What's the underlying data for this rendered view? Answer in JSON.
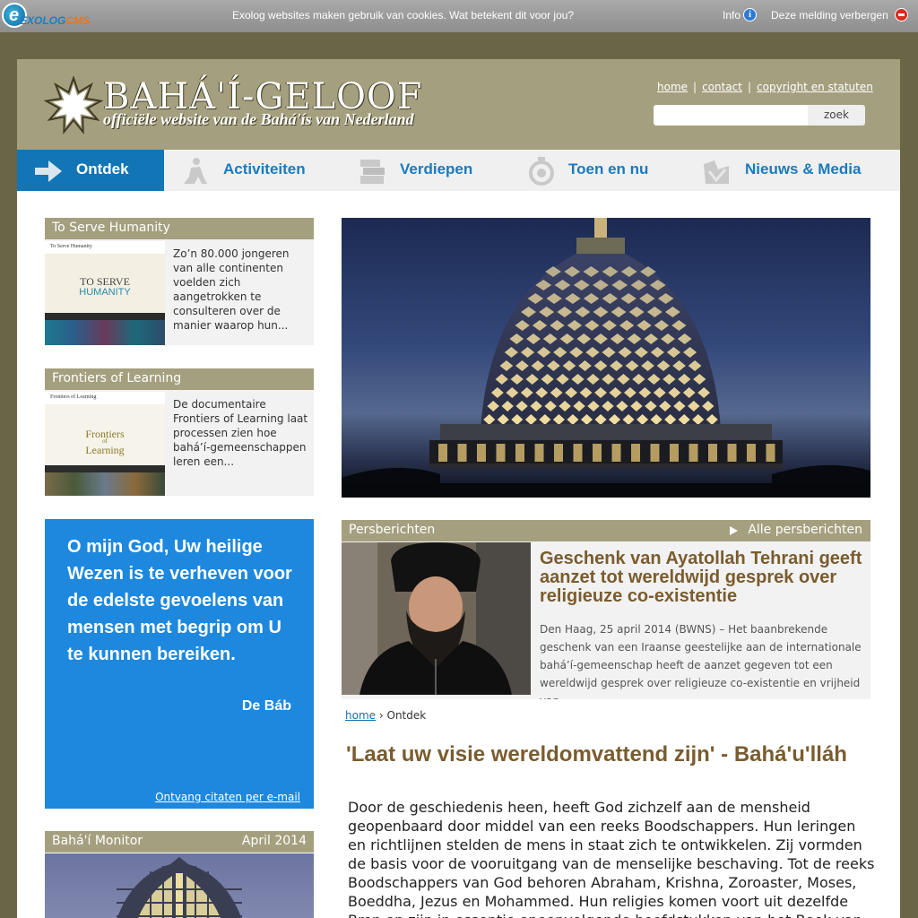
{
  "cookiebar": {
    "logo_text": "EXOLOG",
    "logo_text2": "CMS",
    "message": "Exolog websites maken gebruik van cookies. Wat betekent dit voor jou?",
    "info_label": "Info",
    "hide_label": "Deze melding verbergen"
  },
  "header": {
    "title": "BAHÁ'Í-GELOOF",
    "subtitle": "officiële website van de Bahá'ís van Nederland",
    "links": [
      "home",
      "contact",
      "copyright en statuten"
    ],
    "search_placeholder": "",
    "search_button": "zoek"
  },
  "nav": {
    "items": [
      {
        "label": "Ontdek",
        "icon": "arrow-right-icon",
        "active": true
      },
      {
        "label": "Activiteiten",
        "icon": "activity-icon",
        "active": false
      },
      {
        "label": "Verdiepen",
        "icon": "books-icon",
        "active": false
      },
      {
        "label": "Toen en nu",
        "icon": "stopwatch-icon",
        "active": false
      },
      {
        "label": "Nieuws & Media",
        "icon": "news-icon",
        "active": false
      }
    ]
  },
  "cards": [
    {
      "title": "To Serve Humanity",
      "thumb_small": "To Serve Humanity",
      "thumb_line1": "TO SERVE",
      "thumb_line2": "HUMANITY",
      "text": "Zo’n 80.000 jongeren van alle continenten voelden zich aangetrokken te consulteren over de manier waarop hun..."
    },
    {
      "title": "Frontiers of Learning",
      "thumb_small": "Frontiers of Learning",
      "thumb_line1": "Frontiers",
      "thumb_line2": "of",
      "thumb_line3": "Learning",
      "text": "De documentaire Frontiers of Learning laat processen zien hoe bahá’í-gemeenschappen leren een..."
    }
  ],
  "quote": {
    "text": "O mijn God, Uw heilige Wezen is te verheven voor de edelste gevoelens van mensen met begrip om U te kunnen bereiken.",
    "author": "De Báb",
    "link": "Ontvang citaten per e-mail"
  },
  "monitor": {
    "title": "Bahá'í Monitor",
    "date": "April 2014"
  },
  "press": {
    "section": "Persberichten",
    "all_link": "Alle persberichten",
    "title": "Geschenk van Ayatollah Tehrani geeft aanzet tot wereldwijd gesprek over religieuze co-existentie",
    "body": "Den Haag, 25 april 2014 (BWNS) – Het baanbrekende geschenk van een Iraanse geestelijke aan de internationale bahá’í-gemeenschap heeft de aanzet gegeven tot een wereldwijd gesprek over religieuze co-existentie en vrijheid van..."
  },
  "breadcrumb": {
    "home": "home",
    "separator": "›",
    "current": "Ontdek"
  },
  "main": {
    "title": "'Laat uw visie wereldomvattend zijn' - Bahá'u'lláh",
    "body": "Door de geschiedenis heen, heeft God zichzelf aan de mensheid geopenbaard door middel van een reeks Boodschappers. Hun leringen en richtlijnen stelden de mens in staat zich te ontwikkelen. Zij vormden de basis voor de vooruitgang van de menselijke beschaving. Tot de reeks Boodschappers van God behoren Abraham, Krishna, Zoroaster, Moses, Boeddha, Jezus en Mohammed. Hun religies komen voort uit dezelfde Bron en zijn in essentie opeenvolgende hoofdstukken van het Boek van God."
  },
  "colors": {
    "brand_khaki": "#a49f7e",
    "nav_active": "#1275b5",
    "nav_text": "#1a7bbd",
    "quote_bg": "#1d88dd",
    "heading_brown": "#7a5c2e"
  }
}
